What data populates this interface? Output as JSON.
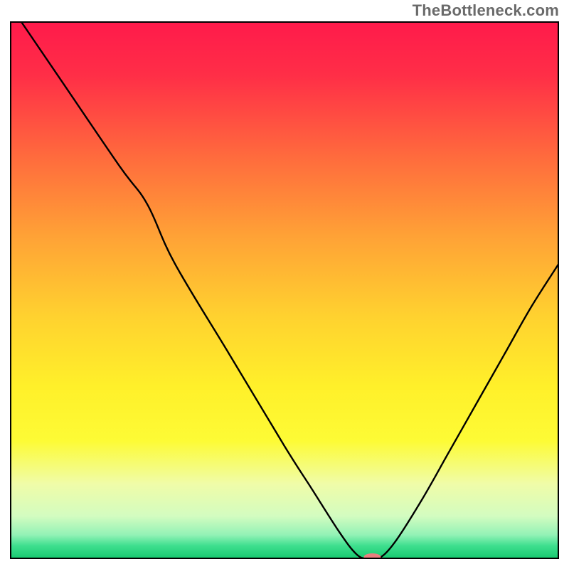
{
  "watermark": "TheBottleneck.com",
  "chart_data": {
    "type": "line",
    "title": "",
    "xlabel": "",
    "ylabel": "",
    "xlim": [
      0,
      100
    ],
    "ylim": [
      0,
      100
    ],
    "grid": false,
    "legend": false,
    "series": [
      {
        "name": "curve",
        "x": [
          2,
          10,
          20,
          25,
          30,
          40,
          50,
          55,
          60,
          63,
          65,
          67,
          70,
          75,
          80,
          85,
          90,
          95,
          100
        ],
        "y": [
          100,
          88,
          73,
          66,
          55,
          38,
          21,
          13,
          5,
          1,
          0,
          0,
          3,
          11,
          20,
          29,
          38,
          47,
          55
        ]
      }
    ],
    "marker": {
      "x": 66,
      "y": 0,
      "color": "#e97f7f",
      "rx": 12,
      "ry": 5
    },
    "background_gradient": {
      "stops": [
        {
          "offset": 0.0,
          "color": "#ff1a4b"
        },
        {
          "offset": 0.1,
          "color": "#ff2e47"
        },
        {
          "offset": 0.25,
          "color": "#ff6a3d"
        },
        {
          "offset": 0.4,
          "color": "#ffa236"
        },
        {
          "offset": 0.55,
          "color": "#ffd22f"
        },
        {
          "offset": 0.68,
          "color": "#fff02a"
        },
        {
          "offset": 0.78,
          "color": "#fdfb35"
        },
        {
          "offset": 0.86,
          "color": "#f0fca8"
        },
        {
          "offset": 0.92,
          "color": "#d3fcc0"
        },
        {
          "offset": 0.955,
          "color": "#93f2b6"
        },
        {
          "offset": 0.975,
          "color": "#3fdf8f"
        },
        {
          "offset": 1.0,
          "color": "#15c96e"
        }
      ]
    },
    "border_color": "#010101"
  }
}
